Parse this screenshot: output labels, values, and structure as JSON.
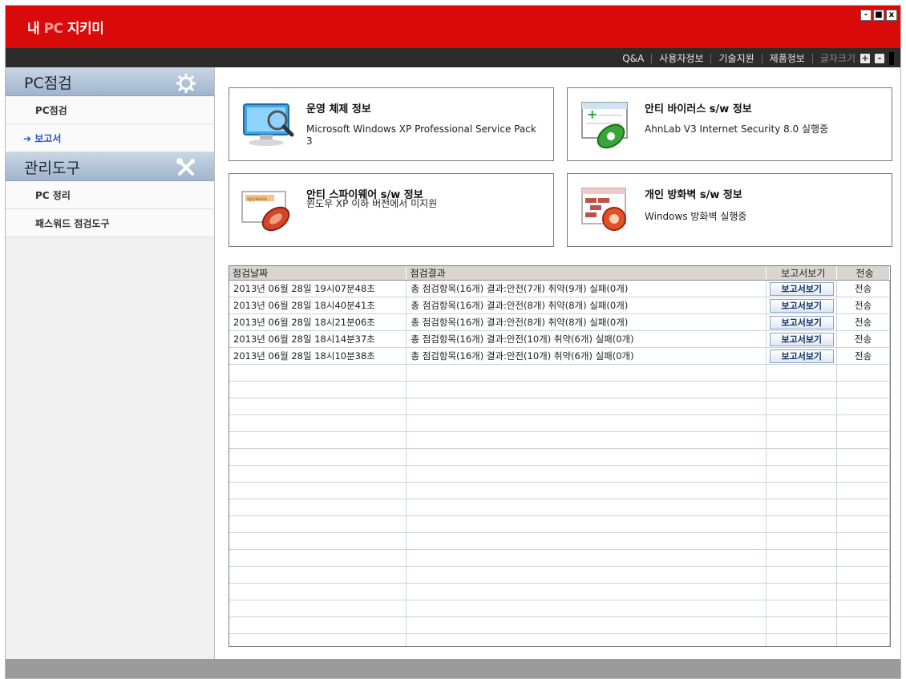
{
  "app": {
    "title_prefix": "내 ",
    "title_pc": "PC",
    "title_suffix": " 지키미",
    "controls": {
      "minimize": "-",
      "maximize": "■",
      "close": "x"
    }
  },
  "topnav": {
    "items": [
      "Q&A",
      "사용자정보",
      "기술지원",
      "제품정보"
    ],
    "font_size_label": "글자크기",
    "font_plus": "+",
    "font_minus": "-"
  },
  "sidebar": {
    "sections": [
      {
        "label": "PC점검",
        "icon": "gear-icon",
        "items": [
          {
            "label": "PC점검",
            "active": false
          },
          {
            "label": "➔ 보고서",
            "active": true
          }
        ]
      },
      {
        "label": "관리도구",
        "icon": "tools-icon",
        "items": [
          {
            "label": "PC 정리",
            "active": false
          },
          {
            "label": "패스워드 점검도구",
            "active": false
          }
        ]
      }
    ]
  },
  "cards": [
    {
      "title": "운영 체제 정보",
      "value": "Microsoft Windows XP Professional Service Pack 3",
      "icon": "monitor-magnifier-icon"
    },
    {
      "title": "안티 바이러스 s/w 정보",
      "value": "AhnLab V3 Internet Security 8.0 실행중",
      "icon": "antivirus-window-icon"
    },
    {
      "title": "안티 스파이웨어 s/w 정보",
      "value": "윈도우 XP 이하 버전에서 미지원",
      "icon": "spyware-shield-icon"
    },
    {
      "title": "개인 방화벽 s/w 정보",
      "value": "Windows 방화벽 실행중",
      "icon": "firewall-icon"
    }
  ],
  "table": {
    "columns": [
      "점검날짜",
      "점검결과",
      "보고서보기",
      "전송"
    ],
    "button_label": "보고서보기",
    "send_label": "전송",
    "rows": [
      {
        "date": "2013년 06월 28일 19시07분48초",
        "result": "총 점검항목(16개) 결과:안전(7개) 취약(9개) 실패(0개)"
      },
      {
        "date": "2013년 06월 28일 18시40분41초",
        "result": "총 점검항목(16개) 결과:안전(8개) 취약(8개) 실패(0개)"
      },
      {
        "date": "2013년 06월 28일 18시21분06초",
        "result": "총 점검항목(16개) 결과:안전(8개) 취약(8개) 실패(0개)"
      },
      {
        "date": "2013년 06월 28일 18시14분37초",
        "result": "총 점검항목(16개) 결과:안전(10개) 취약(6개) 실패(0개)"
      },
      {
        "date": "2013년 06월 28일 18시10분38초",
        "result": "총 점검항목(16개) 결과:안전(10개) 취약(6개) 실패(0개)"
      }
    ]
  },
  "colors": {
    "title_red": "#d90a0a",
    "nav_dark": "#2c2c2c",
    "sidebar_head": "#aebfd3",
    "active_link": "#1e50c8"
  }
}
